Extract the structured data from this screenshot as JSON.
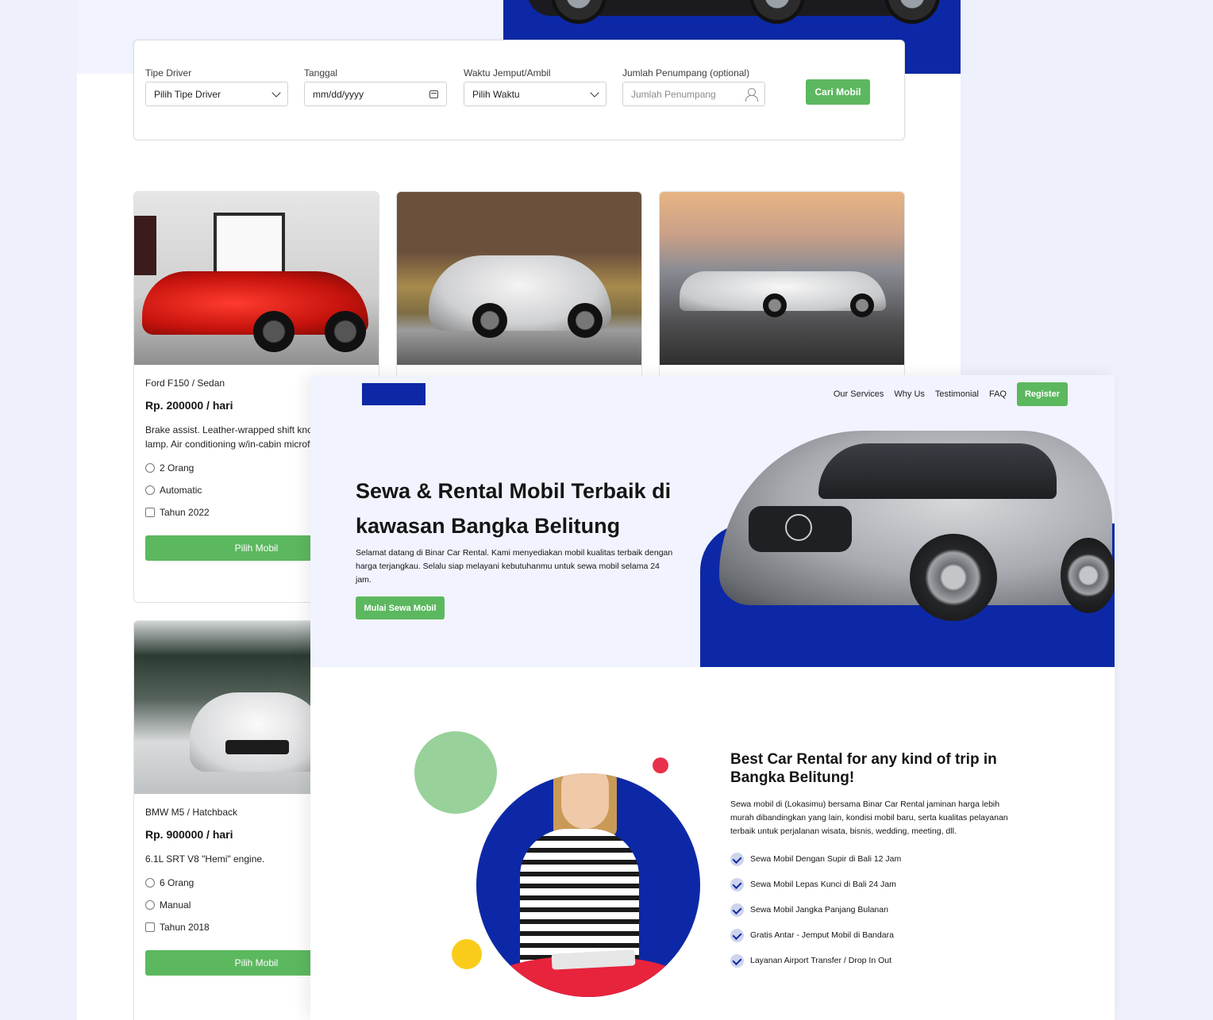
{
  "search": {
    "fields": [
      {
        "label": "Tipe Driver",
        "value": "Pilih Tipe Driver"
      },
      {
        "label": "Tanggal",
        "value": "mm/dd/yyyy"
      },
      {
        "label": "Waktu Jemput/Ambil",
        "value": "Pilih Waktu"
      },
      {
        "label": "Jumlah Penumpang (optional)",
        "placeholder": "Jumlah Penumpang"
      }
    ],
    "button": "Cari Mobil"
  },
  "cars": [
    {
      "name": "Ford F150 / Sedan",
      "price": "Rp. 200000 / hari",
      "desc": "Brake assist. Leather-wrapped shift knob. Glove box lamp. Air conditioning w/in-cabin microfilter.",
      "capacity": "2 Orang",
      "transmission": "Automatic",
      "year": "Tahun 2022",
      "button": "Pilih Mobil"
    },
    {
      "name": "BMW M5 / Hatchback",
      "price": "Rp. 900000 / hari",
      "desc": "6.1L SRT V8 \"Hemi\" engine.",
      "capacity": "6 Orang",
      "transmission": "Manual",
      "year": "Tahun 2018",
      "button": "Pilih Mobil"
    }
  ],
  "nav": {
    "items": [
      "Our Services",
      "Why Us",
      "Testimonial",
      "FAQ"
    ],
    "register": "Register"
  },
  "hero": {
    "title": "Sewa & Rental Mobil Terbaik di kawasan Bangka Belitung",
    "desc": "Selamat datang di Binar Car Rental. Kami menyediakan mobil kualitas terbaik dengan harga terjangkau. Selalu siap melayani kebutuhanmu untuk sewa mobil selama 24 jam.",
    "button": "Mulai Sewa Mobil"
  },
  "why": {
    "title": "Best Car Rental for any kind of trip in Bangka Belitung!",
    "desc": "Sewa mobil di (Lokasimu) bersama Binar Car Rental jaminan harga lebih murah dibandingkan yang lain, kondisi mobil baru, serta kualitas pelayanan terbaik untuk perjalanan wisata, bisnis, wedding, meeting, dll.",
    "items": [
      "Sewa Mobil Dengan Supir di Bali 12 Jam",
      "Sewa Mobil Lepas Kunci di Bali 24 Jam",
      "Sewa Mobil Jangka Panjang Bulanan",
      "Gratis Antar - Jemput Mobil di Bandara",
      "Layanan Airport Transfer / Drop In Out"
    ]
  },
  "colors": {
    "primary_blue": "#0d28a6",
    "green": "#5cb85f",
    "light_bg": "#f1f3fe"
  }
}
